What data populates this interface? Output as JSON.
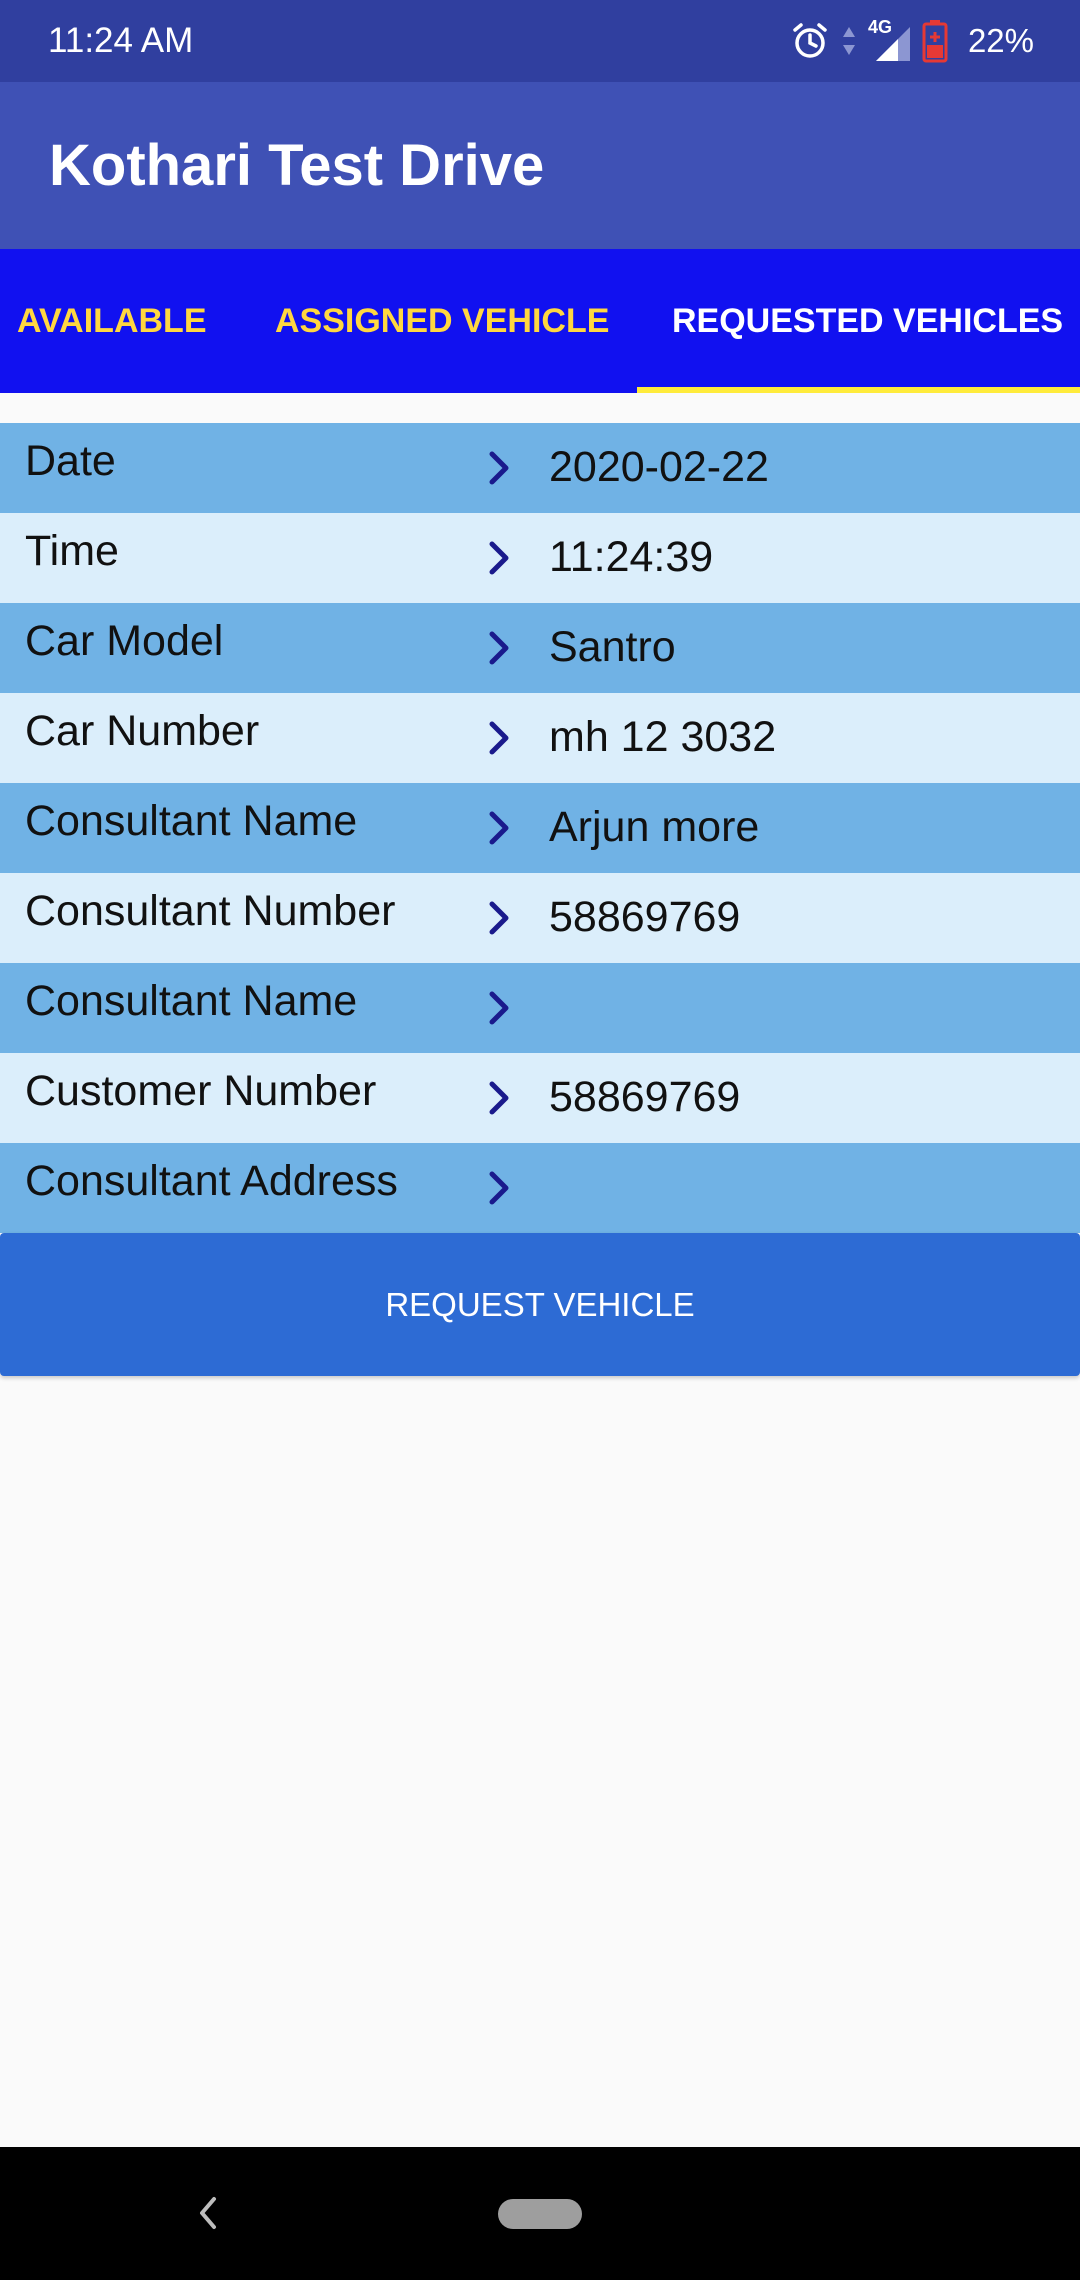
{
  "status_bar": {
    "time": "11:24 AM",
    "network": "4G",
    "battery_percent": "22%",
    "icons": [
      "alarm-icon",
      "network-arrows-icon",
      "signal-icon",
      "battery-low-icon"
    ]
  },
  "app_bar": {
    "title": "Kothari Test Drive"
  },
  "tabs": [
    {
      "label": "AVAILABLE",
      "selected": false
    },
    {
      "label": "ASSIGNED VEHICLE",
      "selected": false
    },
    {
      "label": "REQUESTED VEHICLES",
      "selected": true
    }
  ],
  "details": {
    "rows": [
      {
        "label": "Date",
        "value": "2020-02-22"
      },
      {
        "label": "Time",
        "value": "11:24:39"
      },
      {
        "label": "Car Model",
        "value": "Santro"
      },
      {
        "label": "Car Number",
        "value": "mh 12 3032"
      },
      {
        "label": "Consultant Name",
        "value": "Arjun more"
      },
      {
        "label": "Consultant Number",
        "value": "58869769"
      },
      {
        "label": "Consultant Name",
        "value": ""
      },
      {
        "label": "Customer Number",
        "value": "58869769"
      },
      {
        "label": "Consultant Address",
        "value": ""
      }
    ]
  },
  "actions": {
    "request_label": "REQUEST VEHICLE"
  },
  "colors": {
    "status_bar": "#303f9f",
    "app_bar": "#3f51b5",
    "tab_bar": "#1111f0",
    "tab_text": "#ffd740",
    "tab_indicator": "#ffeb3b",
    "row_dark": "#70b2e5",
    "row_light": "#dbeefb",
    "chevron": "#1a1a8c",
    "button": "#2d6bd4"
  },
  "nav_bar": {
    "icons": [
      "back-icon",
      "home-pill-icon"
    ]
  }
}
